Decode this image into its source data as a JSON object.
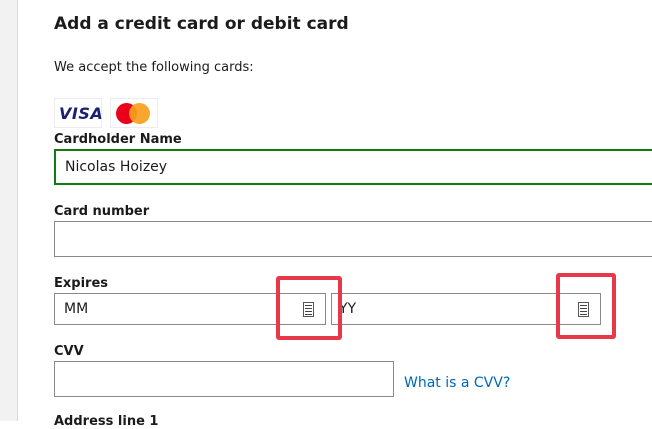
{
  "form": {
    "title": "Add a credit card or debit card",
    "accept_text": "We accept the following cards:",
    "card_brands": [
      "VISA",
      "mastercard"
    ],
    "visa_text": "VISA",
    "cardholder": {
      "label": "Cardholder Name",
      "value": "Nicolas Hoizey"
    },
    "card_number": {
      "label": "Card number",
      "value": ""
    },
    "expires": {
      "label": "Expires",
      "month_value": "MM",
      "year_value": "YY",
      "icon": "dropdown-calendar-icon"
    },
    "cvv": {
      "label": "CVV",
      "value": "",
      "help_link": "What is a CVV?"
    },
    "next_label_partial": "Address line 1"
  },
  "colors": {
    "focus_border": "#107c10",
    "highlight": "#e8394a",
    "link": "#0067b8"
  }
}
